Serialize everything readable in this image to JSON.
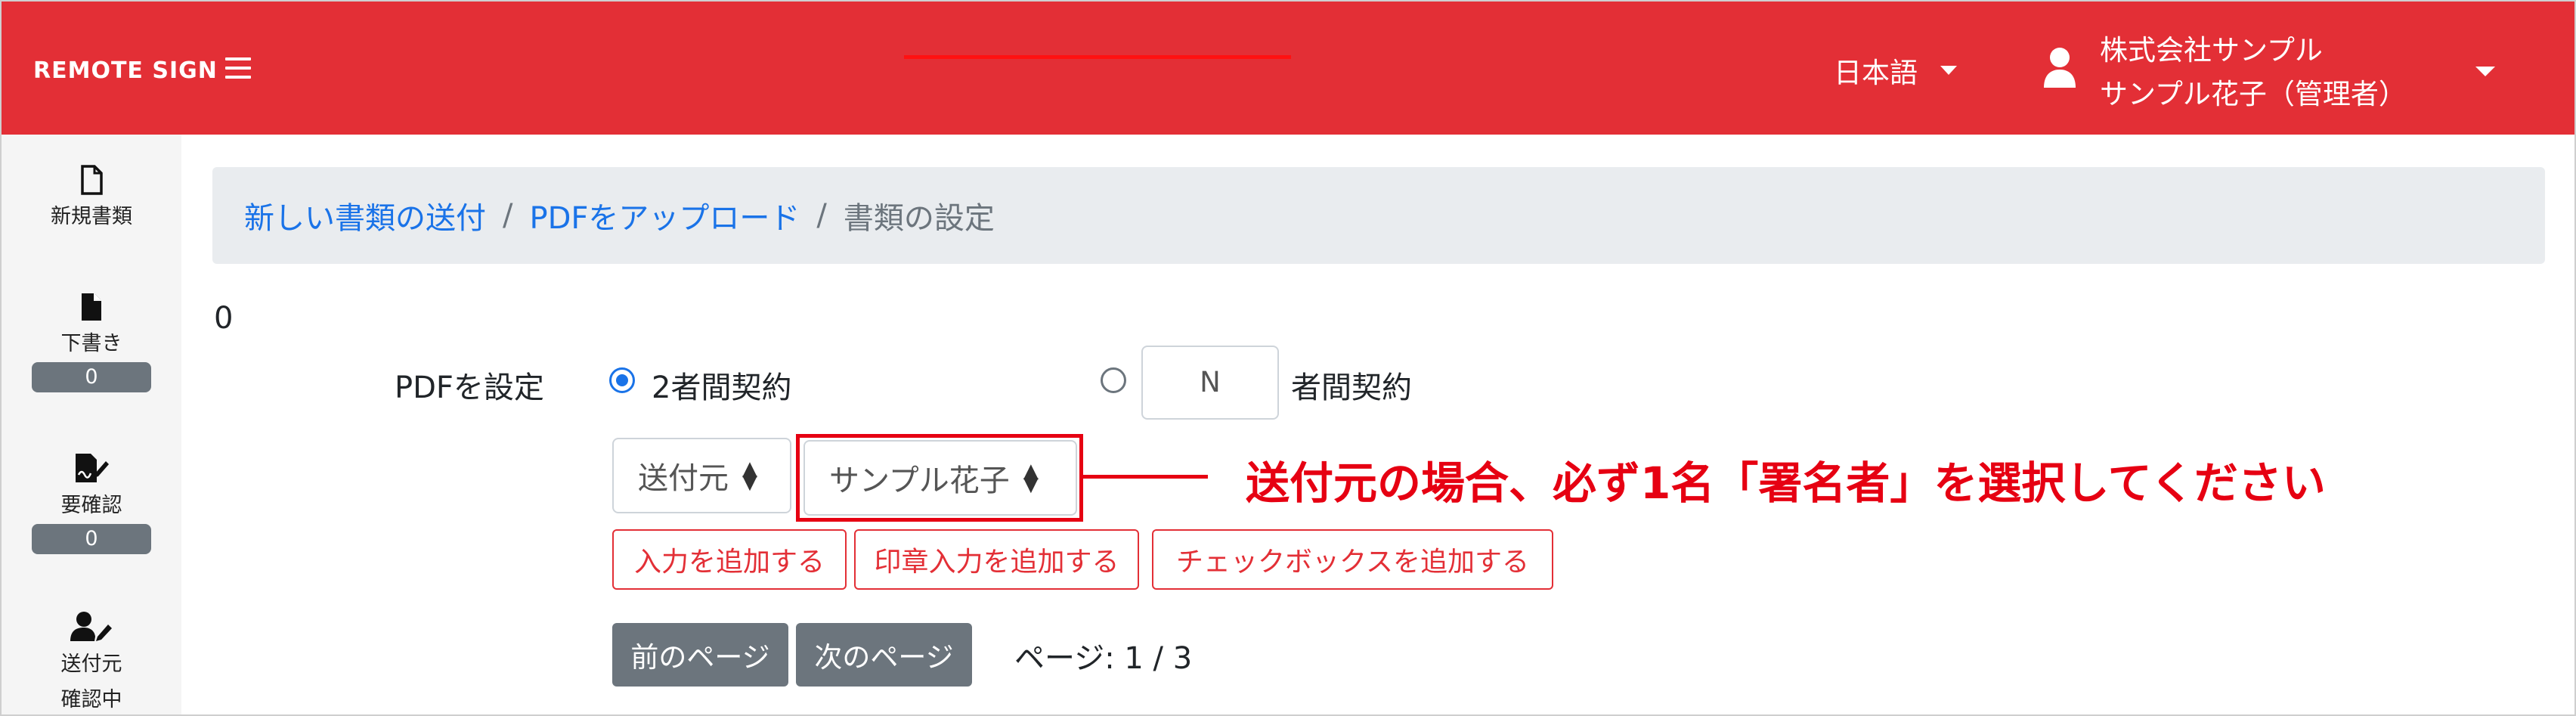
{
  "header": {
    "brand": "REMOTE SIGN",
    "language": "日本語",
    "company": "株式会社サンプル",
    "user": "サンプル花子（管理者）"
  },
  "sidebar": {
    "items": [
      {
        "label": "新規書類",
        "icon": "file-outline-icon"
      },
      {
        "label": "下書き",
        "icon": "file-filled-icon",
        "badge": "0"
      },
      {
        "label": "要確認",
        "icon": "sign-document-icon",
        "badge": "0"
      },
      {
        "label": "送付元",
        "label2": "確認中",
        "icon": "user-edit-icon"
      }
    ]
  },
  "breadcrumb": {
    "item1": "新しい書類の送付",
    "item2": "PDFをアップロード",
    "current": "書類の設定"
  },
  "main": {
    "count": "0",
    "pdf_label": "PDFを設定",
    "radio_two": "2者間契約",
    "n_placeholder": "N",
    "radio_n": "者間契約",
    "sender_select": "送付元",
    "signer_select": "サンプル花子",
    "annotation": "送付元の場合、必ず1名「署名者」を選択してください",
    "add_input": "入力を追加する",
    "add_stamp": "印章入力を追加する",
    "add_checkbox": "チェックボックスを追加する",
    "prev_page": "前のページ",
    "next_page": "次のページ",
    "page_info": "ページ: 1 / 3"
  },
  "colors": {
    "brand_red": "#e32f36",
    "annotation_red": "#e60012",
    "link_blue": "#1a73e8",
    "gray": "#6c757d"
  }
}
